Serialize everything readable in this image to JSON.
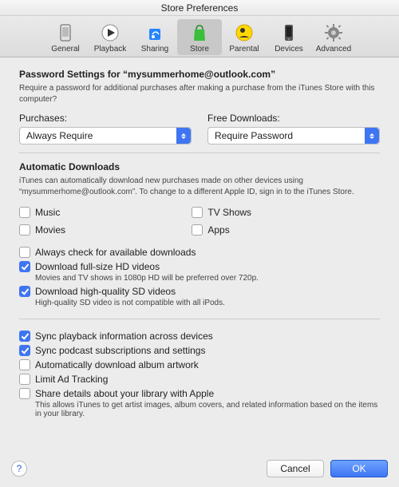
{
  "window_title": "Store Preferences",
  "toolbar": [
    {
      "id": "general",
      "label": "General"
    },
    {
      "id": "playback",
      "label": "Playback"
    },
    {
      "id": "sharing",
      "label": "Sharing"
    },
    {
      "id": "store",
      "label": "Store"
    },
    {
      "id": "parental",
      "label": "Parental"
    },
    {
      "id": "devices",
      "label": "Devices"
    },
    {
      "id": "advanced",
      "label": "Advanced"
    }
  ],
  "password_settings": {
    "heading": "Password Settings for “mysummerhome@outlook.com”",
    "desc": "Require a password for additional purchases after making a purchase from the iTunes Store with this computer?",
    "purchases_label": "Purchases:",
    "purchases_value": "Always Require",
    "free_label": "Free Downloads:",
    "free_value": "Require Password"
  },
  "auto": {
    "heading": "Automatic Downloads",
    "desc": "iTunes can automatically download new purchases made on other devices using “mysummerhome@outlook.com”. To change to a different Apple ID, sign in to the iTunes Store.",
    "music": "Music",
    "movies": "Movies",
    "tvshows": "TV Shows",
    "apps": "Apps",
    "always_check": "Always check for available downloads",
    "hd": "Download full-size HD videos",
    "hd_desc": "Movies and TV shows in 1080p HD will be preferred over 720p.",
    "sd": "Download high-quality SD videos",
    "sd_desc": "High-quality SD video is not compatible with all iPods."
  },
  "sync": {
    "playback": "Sync playback information across devices",
    "podcast": "Sync podcast subscriptions and settings",
    "artwork": "Automatically download album artwork",
    "limit_ad": "Limit Ad Tracking",
    "share": "Share details about your library with Apple",
    "share_desc": "This allows iTunes to get artist images, album covers, and related information based on the items in your library."
  },
  "footer": {
    "help": "?",
    "cancel": "Cancel",
    "ok": "OK"
  }
}
